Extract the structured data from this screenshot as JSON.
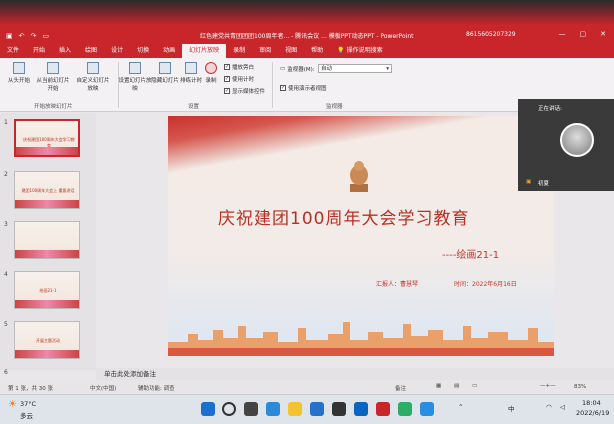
{
  "window": {
    "title": "红色建党共青团团团100周年者... - 腾讯会议 ... 模板PPT动态PPT - PowerPoint",
    "phone": "8615605207329",
    "meeting_indicator": "腾讯会议"
  },
  "menu_tabs": [
    "文件",
    "开始",
    "插入",
    "绘图",
    "设计",
    "切换",
    "动画",
    "幻灯片放映",
    "录制",
    "审阅",
    "视图",
    "帮助",
    "操作说明搜索"
  ],
  "active_tab": "幻灯片放映",
  "ribbon": {
    "from_start": "从头开始",
    "from_current": "从当前幻灯片开始",
    "custom_show": "自定义幻灯片放映",
    "group_start": "开始放映幻灯片",
    "setup": "设置幻灯片放映",
    "hide": "隐藏幻灯片",
    "rehearse": "排练计时",
    "record": "录制",
    "chk_narration": "播放旁白",
    "chk_timing": "使用计时",
    "chk_media": "显示媒体控件",
    "group_setup": "设置",
    "monitor_label": "监视器(M):",
    "monitor_value": "自动",
    "presenter_view": "使用演示者视图",
    "group_monitor": "监视器"
  },
  "thumbs": [
    {
      "num": "1",
      "title": "庆祝建团100周年大会学习教育"
    },
    {
      "num": "2",
      "title": "建团100周年大会上 重要讲话"
    },
    {
      "num": "3",
      "title": ""
    },
    {
      "num": "4",
      "title": "绘画21-1"
    },
    {
      "num": "5",
      "title": "开展主题活动"
    },
    {
      "num": "6",
      "title": ""
    }
  ],
  "slide": {
    "title": "庆祝建团100周年大会学习教育",
    "subtitle": "----绘画21-1",
    "reporter": "汇报人：曹慧琴",
    "time": "时间：2022年6月16日"
  },
  "notes_placeholder": "单击此处添加备注",
  "status": {
    "slide_info": "第 1 张，共 30 张",
    "lang": "中文(中国)",
    "accessibility": "辅助功能: 调查",
    "notes_btn": "备注",
    "zoom": "83%"
  },
  "meeting": {
    "speaking": "正在讲话:",
    "name": "初夏"
  },
  "taskbar": {
    "weather_temp": "37°C",
    "weather_desc": "多云",
    "ime": "中",
    "time": "18:04",
    "date": "2022/6/19"
  }
}
